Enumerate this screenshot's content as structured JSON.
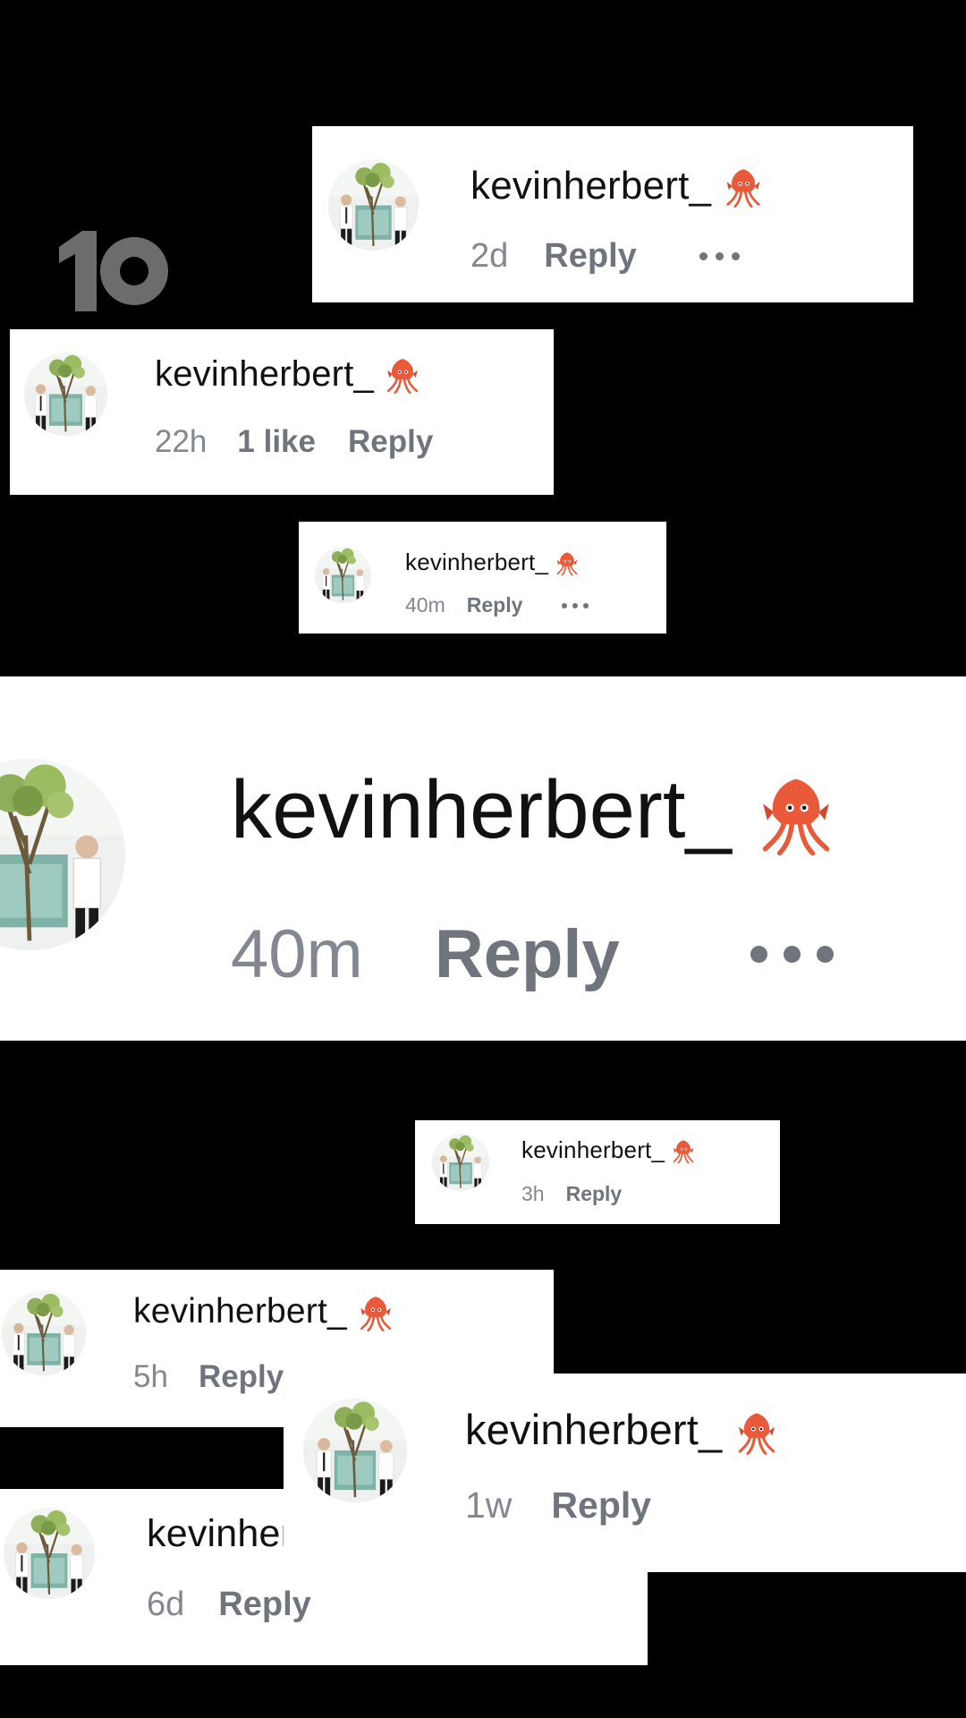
{
  "colors": {
    "background": "#000000",
    "card": "#ffffff",
    "username": "#111111",
    "meta": "#6f747d",
    "squid": "#e85a3a"
  },
  "logo": {
    "name": "network-ten-logo",
    "text": "10"
  },
  "comments": [
    {
      "username": "kevinherbert_",
      "emoji": "squid-emoji",
      "time": "2d",
      "reply": "Reply",
      "more": "more-options-icon"
    },
    {
      "username": "kevinherbert_",
      "emoji": "squid-emoji",
      "time": "22h",
      "likes": "1 like",
      "reply": "Reply"
    },
    {
      "username": "kevinherbert_",
      "emoji": "squid-emoji",
      "time": "40m",
      "reply": "Reply",
      "more": "more-options-icon"
    },
    {
      "username": "kevinherbert_",
      "emoji": "squid-emoji",
      "time": "40m",
      "reply": "Reply",
      "more": "more-options-icon"
    },
    {
      "username": "kevinherbert_",
      "emoji": "squid-emoji",
      "time": "3h",
      "reply": "Reply"
    },
    {
      "username": "kevinherbert_",
      "emoji": "squid-emoji",
      "time": "5h",
      "reply": "Reply"
    },
    {
      "username": "kevinherbert_",
      "emoji": "squid-emoji",
      "time": "6d",
      "reply": "Reply"
    },
    {
      "username": "kevinherbert_",
      "emoji": "squid-emoji",
      "time": "1w",
      "reply": "Reply"
    }
  ]
}
